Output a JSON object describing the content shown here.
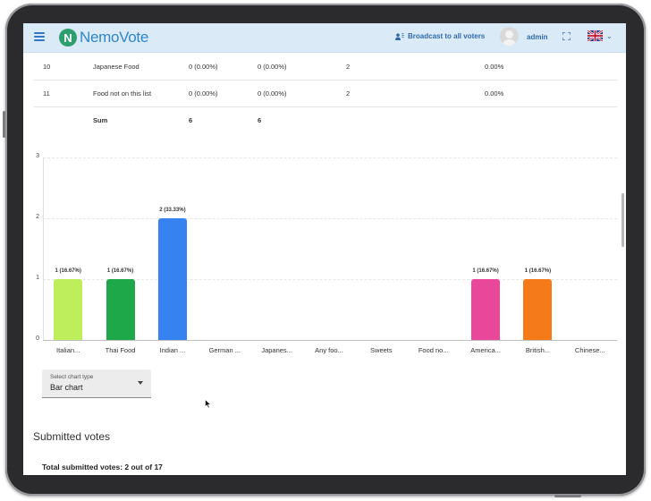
{
  "app": {
    "logo_letter": "N",
    "logo_text": "NemoVote"
  },
  "header": {
    "broadcast_label": "Broadcast to all voters",
    "user_name": "admin"
  },
  "table": {
    "rows": [
      {
        "index": "10",
        "option": "Japanese Food",
        "votes_a": "0 (0.00%)",
        "votes_b": "0 (0.00%)",
        "count": "2",
        "pct": "0.00%"
      },
      {
        "index": "11",
        "option": "Food not on this list",
        "votes_a": "0 (0.00%)",
        "votes_b": "0 (0.00%)",
        "count": "2",
        "pct": "0.00%"
      }
    ],
    "sum": {
      "label": "Sum",
      "a": "6",
      "b": "6"
    }
  },
  "chart_data": {
    "type": "bar",
    "categories": [
      "Italian...",
      "Thai Food",
      "Indian ...",
      "German ...",
      "Japanes...",
      "Any foo...",
      "Sweets",
      "Food no...",
      "America...",
      "British...",
      "Chinese..."
    ],
    "values": [
      1,
      1,
      2,
      0,
      0,
      0,
      0,
      0,
      1,
      1,
      0
    ],
    "data_labels": [
      "1 (16.67%)",
      "1 (16.67%)",
      "2 (33.33%)",
      "",
      "",
      "",
      "",
      "",
      "1 (16.67%)",
      "1 (16.67%)",
      ""
    ],
    "colors": [
      "#bfee5c",
      "#1fa84a",
      "#3582f0",
      "",
      "",
      "",
      "",
      "",
      "#e8479a",
      "#f47a1a",
      ""
    ],
    "ylim": [
      0,
      3
    ],
    "yticks": [
      "0",
      "1",
      "2",
      "3"
    ],
    "grid": true
  },
  "chart_type_select": {
    "label": "Select chart type",
    "value": "Bar chart"
  },
  "submitted": {
    "title": "Submitted votes",
    "total": "Total submitted votes: 2 out of 17"
  }
}
